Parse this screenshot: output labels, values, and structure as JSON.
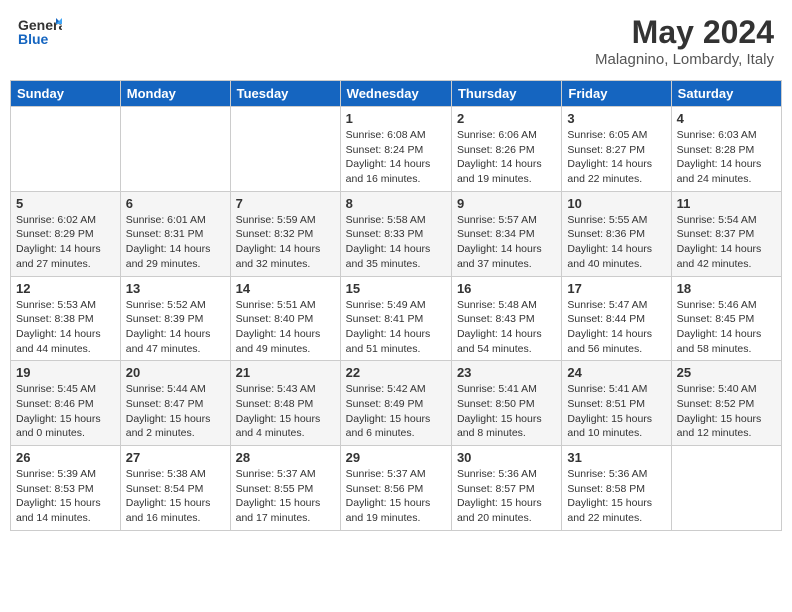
{
  "header": {
    "logo_general": "General",
    "logo_blue": "Blue",
    "month": "May 2024",
    "location": "Malagnino, Lombardy, Italy"
  },
  "weekdays": [
    "Sunday",
    "Monday",
    "Tuesday",
    "Wednesday",
    "Thursday",
    "Friday",
    "Saturday"
  ],
  "weeks": [
    [
      {
        "day": "",
        "info": ""
      },
      {
        "day": "",
        "info": ""
      },
      {
        "day": "",
        "info": ""
      },
      {
        "day": "1",
        "info": "Sunrise: 6:08 AM\nSunset: 8:24 PM\nDaylight: 14 hours and 16 minutes."
      },
      {
        "day": "2",
        "info": "Sunrise: 6:06 AM\nSunset: 8:26 PM\nDaylight: 14 hours and 19 minutes."
      },
      {
        "day": "3",
        "info": "Sunrise: 6:05 AM\nSunset: 8:27 PM\nDaylight: 14 hours and 22 minutes."
      },
      {
        "day": "4",
        "info": "Sunrise: 6:03 AM\nSunset: 8:28 PM\nDaylight: 14 hours and 24 minutes."
      }
    ],
    [
      {
        "day": "5",
        "info": "Sunrise: 6:02 AM\nSunset: 8:29 PM\nDaylight: 14 hours and 27 minutes."
      },
      {
        "day": "6",
        "info": "Sunrise: 6:01 AM\nSunset: 8:31 PM\nDaylight: 14 hours and 29 minutes."
      },
      {
        "day": "7",
        "info": "Sunrise: 5:59 AM\nSunset: 8:32 PM\nDaylight: 14 hours and 32 minutes."
      },
      {
        "day": "8",
        "info": "Sunrise: 5:58 AM\nSunset: 8:33 PM\nDaylight: 14 hours and 35 minutes."
      },
      {
        "day": "9",
        "info": "Sunrise: 5:57 AM\nSunset: 8:34 PM\nDaylight: 14 hours and 37 minutes."
      },
      {
        "day": "10",
        "info": "Sunrise: 5:55 AM\nSunset: 8:36 PM\nDaylight: 14 hours and 40 minutes."
      },
      {
        "day": "11",
        "info": "Sunrise: 5:54 AM\nSunset: 8:37 PM\nDaylight: 14 hours and 42 minutes."
      }
    ],
    [
      {
        "day": "12",
        "info": "Sunrise: 5:53 AM\nSunset: 8:38 PM\nDaylight: 14 hours and 44 minutes."
      },
      {
        "day": "13",
        "info": "Sunrise: 5:52 AM\nSunset: 8:39 PM\nDaylight: 14 hours and 47 minutes."
      },
      {
        "day": "14",
        "info": "Sunrise: 5:51 AM\nSunset: 8:40 PM\nDaylight: 14 hours and 49 minutes."
      },
      {
        "day": "15",
        "info": "Sunrise: 5:49 AM\nSunset: 8:41 PM\nDaylight: 14 hours and 51 minutes."
      },
      {
        "day": "16",
        "info": "Sunrise: 5:48 AM\nSunset: 8:43 PM\nDaylight: 14 hours and 54 minutes."
      },
      {
        "day": "17",
        "info": "Sunrise: 5:47 AM\nSunset: 8:44 PM\nDaylight: 14 hours and 56 minutes."
      },
      {
        "day": "18",
        "info": "Sunrise: 5:46 AM\nSunset: 8:45 PM\nDaylight: 14 hours and 58 minutes."
      }
    ],
    [
      {
        "day": "19",
        "info": "Sunrise: 5:45 AM\nSunset: 8:46 PM\nDaylight: 15 hours and 0 minutes."
      },
      {
        "day": "20",
        "info": "Sunrise: 5:44 AM\nSunset: 8:47 PM\nDaylight: 15 hours and 2 minutes."
      },
      {
        "day": "21",
        "info": "Sunrise: 5:43 AM\nSunset: 8:48 PM\nDaylight: 15 hours and 4 minutes."
      },
      {
        "day": "22",
        "info": "Sunrise: 5:42 AM\nSunset: 8:49 PM\nDaylight: 15 hours and 6 minutes."
      },
      {
        "day": "23",
        "info": "Sunrise: 5:41 AM\nSunset: 8:50 PM\nDaylight: 15 hours and 8 minutes."
      },
      {
        "day": "24",
        "info": "Sunrise: 5:41 AM\nSunset: 8:51 PM\nDaylight: 15 hours and 10 minutes."
      },
      {
        "day": "25",
        "info": "Sunrise: 5:40 AM\nSunset: 8:52 PM\nDaylight: 15 hours and 12 minutes."
      }
    ],
    [
      {
        "day": "26",
        "info": "Sunrise: 5:39 AM\nSunset: 8:53 PM\nDaylight: 15 hours and 14 minutes."
      },
      {
        "day": "27",
        "info": "Sunrise: 5:38 AM\nSunset: 8:54 PM\nDaylight: 15 hours and 16 minutes."
      },
      {
        "day": "28",
        "info": "Sunrise: 5:37 AM\nSunset: 8:55 PM\nDaylight: 15 hours and 17 minutes."
      },
      {
        "day": "29",
        "info": "Sunrise: 5:37 AM\nSunset: 8:56 PM\nDaylight: 15 hours and 19 minutes."
      },
      {
        "day": "30",
        "info": "Sunrise: 5:36 AM\nSunset: 8:57 PM\nDaylight: 15 hours and 20 minutes."
      },
      {
        "day": "31",
        "info": "Sunrise: 5:36 AM\nSunset: 8:58 PM\nDaylight: 15 hours and 22 minutes."
      },
      {
        "day": "",
        "info": ""
      }
    ]
  ]
}
